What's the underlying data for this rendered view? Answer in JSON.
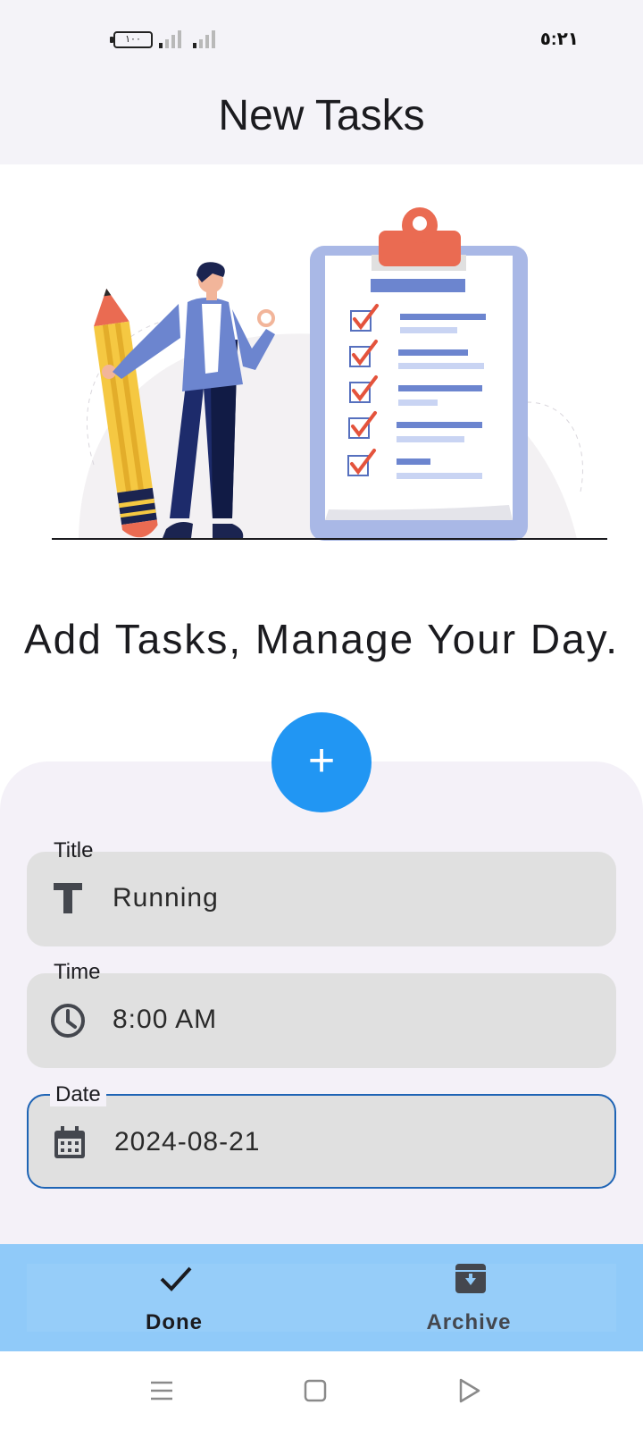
{
  "status_bar": {
    "battery": "١٠٠",
    "time": "٥:٢١"
  },
  "app_bar": {
    "title": "New Tasks"
  },
  "headline": "Add Tasks, Manage Your Day.",
  "fab": {
    "icon": "plus-icon",
    "label": "+"
  },
  "form": {
    "title": {
      "label": "Title",
      "value": "Running",
      "icon": "text-format-icon"
    },
    "time": {
      "label": "Time",
      "value": "8:00 AM",
      "icon": "clock-icon"
    },
    "date": {
      "label": "Date",
      "value": "2024-08-21",
      "icon": "calendar-icon"
    }
  },
  "bottom_nav": {
    "items": [
      {
        "label": "Done",
        "icon": "check-icon"
      },
      {
        "label": "Archive",
        "icon": "archive-icon"
      }
    ]
  },
  "colors": {
    "accent": "#2196f3",
    "bottom_nav_bg": "#90caf9",
    "focus_border": "#1e64b5",
    "field_bg": "#e0e0e0",
    "sheet_bg": "#f4f1f8"
  }
}
